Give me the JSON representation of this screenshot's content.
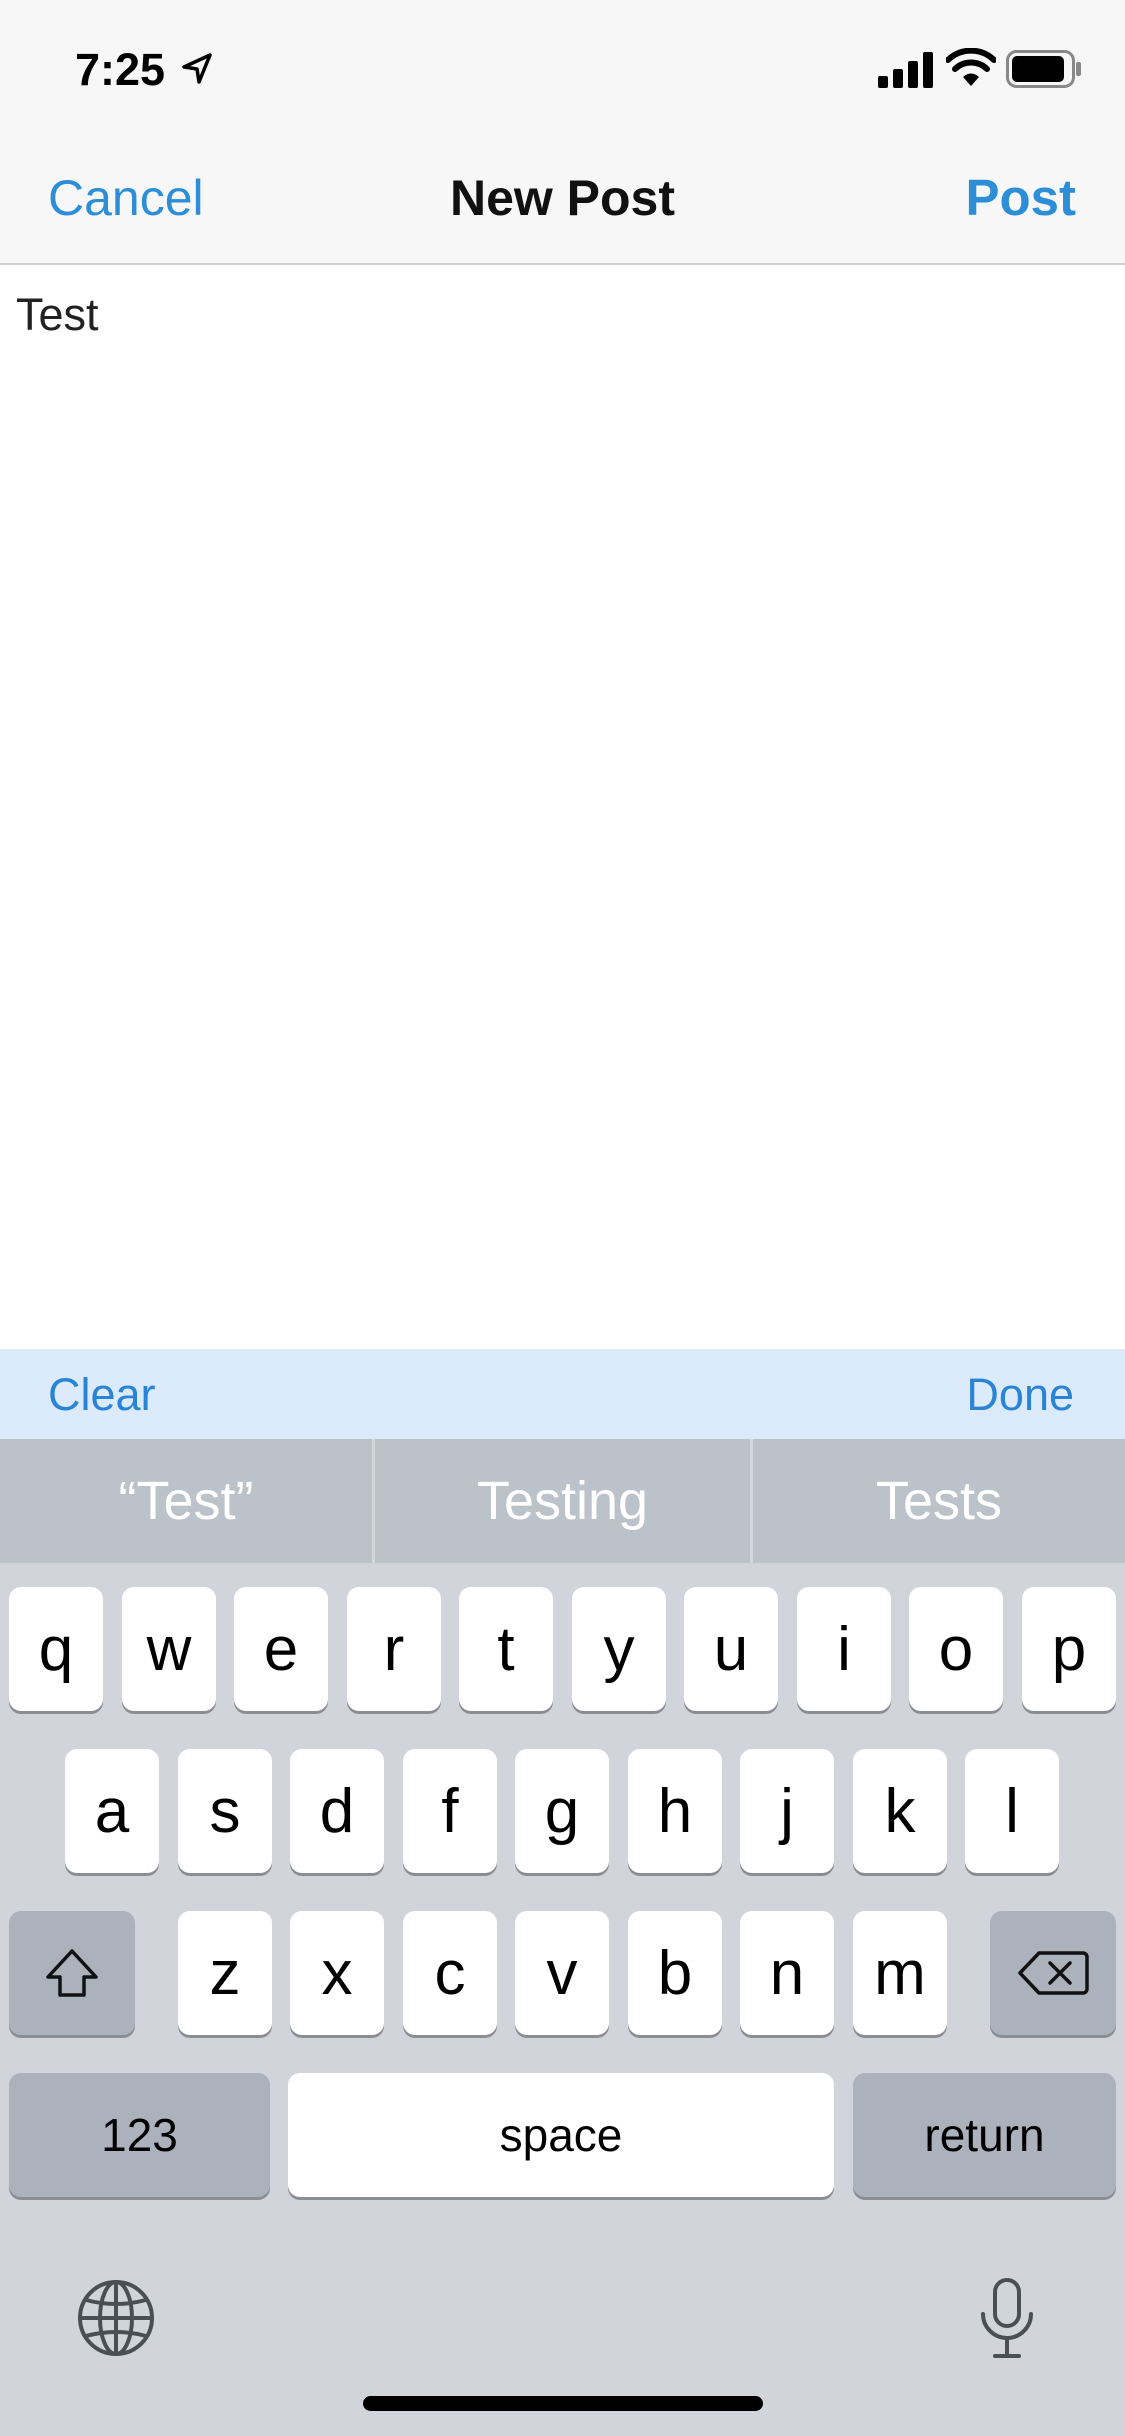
{
  "status_bar": {
    "time": "7:25"
  },
  "nav": {
    "cancel_label": "Cancel",
    "title": "New Post",
    "post_label": "Post",
    "accent_color": "#2d8ed8"
  },
  "editor": {
    "text": "Test"
  },
  "accessory_bar": {
    "clear_label": "Clear",
    "done_label": "Done"
  },
  "predictions": [
    "“Test”",
    "Testing",
    "Tests"
  ],
  "keyboard": {
    "row1": [
      "q",
      "w",
      "e",
      "r",
      "t",
      "y",
      "u",
      "i",
      "o",
      "p"
    ],
    "row2": [
      "a",
      "s",
      "d",
      "f",
      "g",
      "h",
      "j",
      "k",
      "l"
    ],
    "row3": [
      "z",
      "x",
      "c",
      "v",
      "b",
      "n",
      "m"
    ],
    "numbers_label": "123",
    "space_label": "space",
    "return_label": "return",
    "icons": [
      "shift-icon",
      "backspace-icon",
      "globe-icon",
      "microphone-icon"
    ]
  }
}
